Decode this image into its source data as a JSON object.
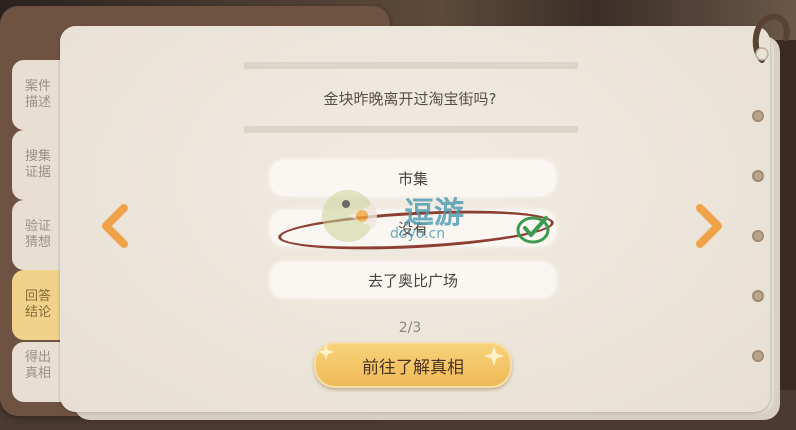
{
  "tabs": [
    {
      "label": "案件描述",
      "active": false
    },
    {
      "label": "搜集证据",
      "active": false
    },
    {
      "label": "验证猜想",
      "active": false
    },
    {
      "label": "回答结论",
      "active": true
    },
    {
      "label": "得出真相",
      "active": false
    }
  ],
  "question": "金块昨晚离开过淘宝街吗?",
  "options": [
    {
      "label": "市集",
      "selected": false
    },
    {
      "label": "没有",
      "selected": true
    },
    {
      "label": "去了奥比广场",
      "selected": false
    }
  ],
  "pager": "2/3",
  "truth_button_label": "前往了解真相",
  "watermark": {
    "title": "逗游",
    "url": "doyo.cn"
  },
  "colors": {
    "accent_orange": "#f0a24a",
    "selected_ring": "#8c3f32",
    "check_green": "#3e9a52",
    "button_gold": "#f2c262"
  },
  "icons": {
    "left_arrow": "chevron-left-icon",
    "right_arrow": "chevron-right-icon",
    "check": "check-icon"
  }
}
